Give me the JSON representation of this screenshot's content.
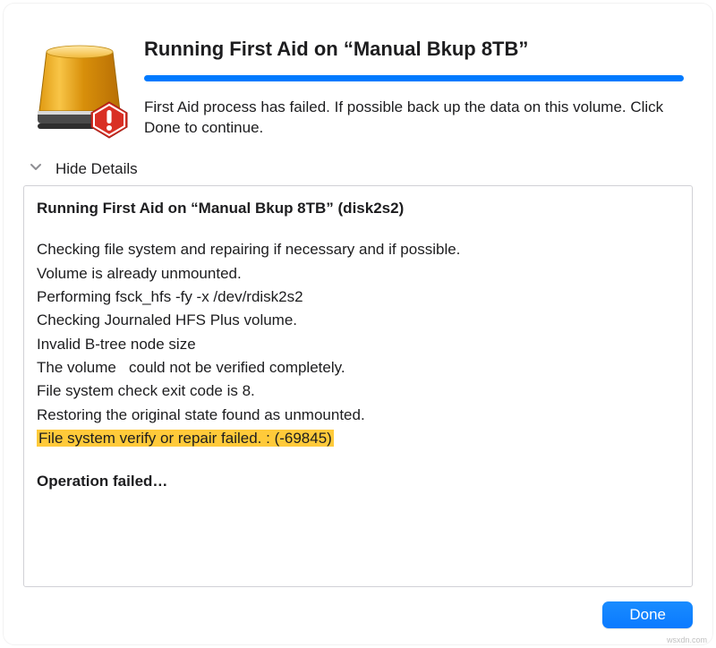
{
  "header": {
    "title": "Running First Aid on “Manual Bkup 8TB”",
    "subtitle": "First Aid process has failed. If possible back up the data on this volume. Click Done to continue.",
    "progress_percent": 100
  },
  "toggle": {
    "label": "Hide Details"
  },
  "details": {
    "heading": "Running First Aid on “Manual Bkup 8TB” (disk2s2)",
    "log": [
      "Checking file system and repairing if necessary and if possible.",
      "Volume is already unmounted.",
      "Performing fsck_hfs -fy -x /dev/rdisk2s2",
      "Checking Journaled HFS Plus volume.",
      "Invalid B-tree node size",
      "The volume   could not be verified completely.",
      "File system check exit code is 8.",
      "Restoring the original state found as unmounted."
    ],
    "highlighted": "File system verify or repair failed. : (-69845)",
    "operation": "Operation failed…"
  },
  "footer": {
    "done_label": "Done"
  },
  "watermark": "wsxdn.com",
  "colors": {
    "accent": "#007aff",
    "highlight": "#ffca3a"
  }
}
